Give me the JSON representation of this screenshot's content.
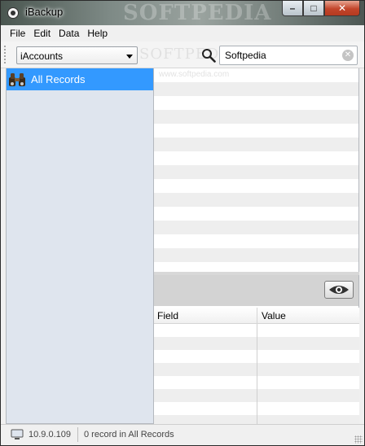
{
  "window": {
    "title": "iBackup",
    "watermark": "SOFTPEDIA",
    "controls": {
      "minimize": "–",
      "maximize": "□",
      "close": "✕"
    }
  },
  "menu": {
    "items": [
      "File",
      "Edit",
      "Data",
      "Help"
    ]
  },
  "toolbar": {
    "category_select": {
      "value": "iAccounts"
    },
    "watermark": "SOFTPEDIA",
    "search": {
      "value": "Softpedia",
      "clear_icon": "✕"
    }
  },
  "sidebar": {
    "items": [
      {
        "label": "All Records",
        "icon": "binoculars-icon",
        "selected": true
      }
    ]
  },
  "records": {
    "watermark": "www.softpedia.com"
  },
  "details": {
    "columns": [
      "Field",
      "Value"
    ]
  },
  "status": {
    "version": "10.9.0.109",
    "records_text": "0 record in All Records"
  },
  "colors": {
    "selection": "#3399ff",
    "sidebar_bg": "#dfe5ee",
    "close_button": "#c2452a"
  }
}
